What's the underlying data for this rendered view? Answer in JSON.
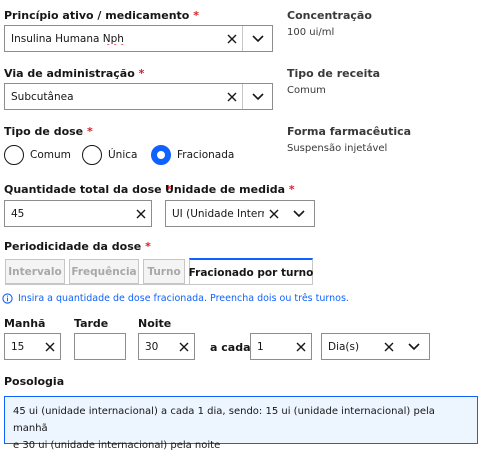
{
  "principio": {
    "label": "Princípio ativo / medicamento",
    "required": "*",
    "value": "Insulina Humana Nph",
    "value_main": "Insulina Humana ",
    "value_underlined": "Nph"
  },
  "concentracao": {
    "label": "Concentração",
    "value": "100 ui/ml"
  },
  "via": {
    "label": "Via de administração",
    "required": "*",
    "value": "Subcutânea"
  },
  "tipo_receita": {
    "label": "Tipo de receita",
    "value": "Comum"
  },
  "tipo_dose": {
    "label": "Tipo de dose",
    "required": "*",
    "options": [
      {
        "label": "Comum",
        "selected": false
      },
      {
        "label": "Única",
        "selected": false
      },
      {
        "label": "Fracionada",
        "selected": true
      }
    ]
  },
  "forma": {
    "label": "Forma farmacêutica",
    "value": "Suspensão injetável"
  },
  "quantidade": {
    "label": "Quantidade total da dose",
    "required": "*",
    "value": "45"
  },
  "unidade": {
    "label": "Unidade de medida",
    "required": "*",
    "value": "UI (Unidade Internacional)"
  },
  "periodicidade": {
    "label": "Periodicidade da dose",
    "required": "*",
    "tabs": [
      {
        "label": "Intervalo",
        "active": false
      },
      {
        "label": "Frequência",
        "active": false
      },
      {
        "label": "Turno",
        "active": false
      },
      {
        "label": "Fracionado por turno",
        "active": true
      }
    ]
  },
  "info_text": "Insira a quantidade de dose fracionada. Preencha dois ou três turnos.",
  "turnos": {
    "manha": {
      "label": "Manhã",
      "value": "15"
    },
    "tarde": {
      "label": "Tarde",
      "value": ""
    },
    "noite": {
      "label": "Noite",
      "value": "30"
    },
    "a_cada_label": "a cada",
    "a_cada_value": "1",
    "periodo_value": "Dia(s)"
  },
  "posologia": {
    "label": "Posologia",
    "text_line1": "45 ui (unidade internacional) a cada 1 dia, sendo: 15 ui (unidade internacional) pela manhã",
    "text_line2": "e 30 ui (unidade internacional) pela noite"
  },
  "colors": {
    "accent": "#0f62fe",
    "required": "#da1e28",
    "info_bg": "#edf5ff"
  }
}
